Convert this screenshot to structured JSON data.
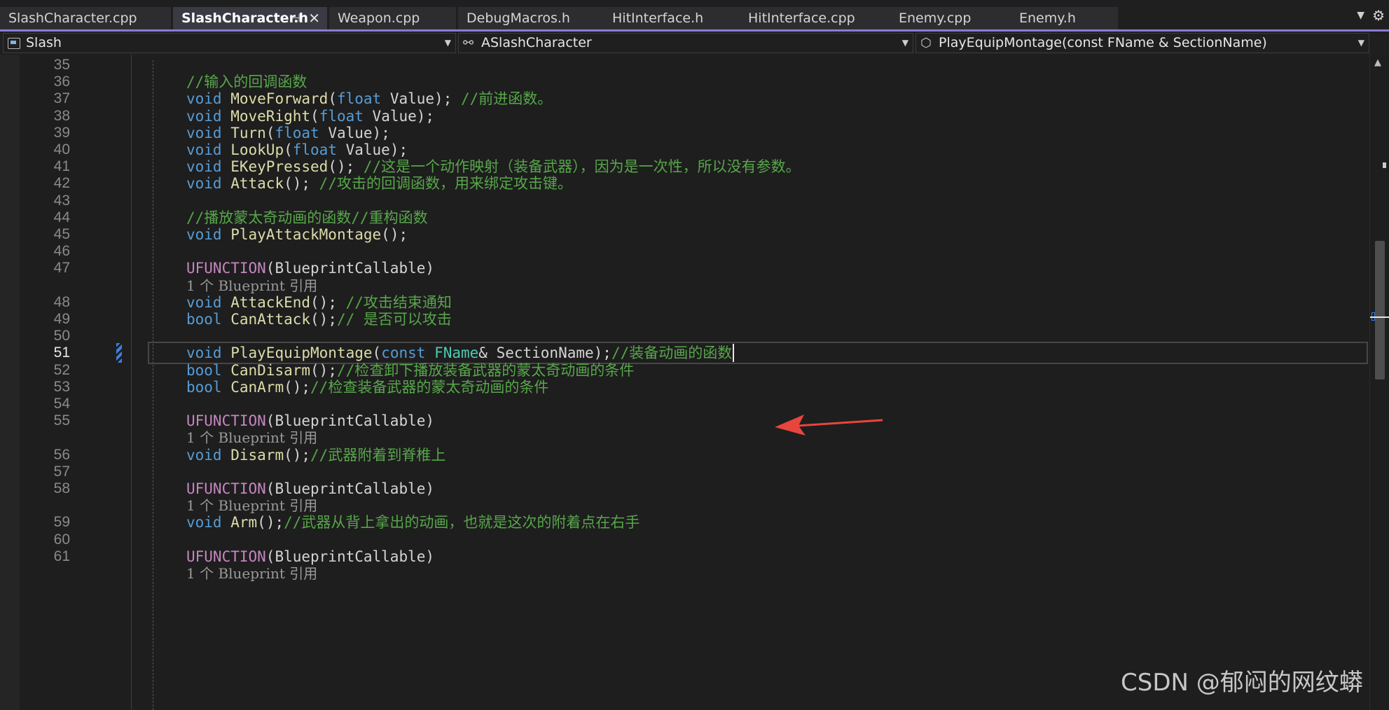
{
  "tabs": [
    {
      "label": "SlashCharacter.cpp",
      "active": false
    },
    {
      "label": "SlashCharacter.h",
      "active": true
    },
    {
      "label": "Weapon.cpp",
      "active": false
    },
    {
      "label": "DebugMacros.h",
      "active": false
    },
    {
      "label": "HitInterface.h",
      "active": false
    },
    {
      "label": "HitInterface.cpp",
      "active": false
    },
    {
      "label": "Enemy.cpp",
      "active": false
    },
    {
      "label": "Enemy.h",
      "active": false
    }
  ],
  "tab_active_pin_icon": "pin-icon",
  "tab_active_close": "✕",
  "navbar": {
    "project": "Slash",
    "scope": "ASlashCharacter",
    "member": "PlayEquipMontage(const FName & SectionName)"
  },
  "editor": {
    "current_line": 51,
    "lines": [
      {
        "n": "35",
        "tokens": []
      },
      {
        "n": "36",
        "tokens": [
          {
            "t": "//输入的回调函数",
            "c": "cm"
          }
        ]
      },
      {
        "n": "37",
        "tokens": [
          {
            "t": "void",
            "c": "kw"
          },
          {
            "t": " ",
            "c": "pl"
          },
          {
            "t": "MoveForward",
            "c": "fn"
          },
          {
            "t": "(",
            "c": "pl"
          },
          {
            "t": "float",
            "c": "kw"
          },
          {
            "t": " Value); ",
            "c": "pl"
          },
          {
            "t": "//前进函数。",
            "c": "cm"
          }
        ]
      },
      {
        "n": "38",
        "tokens": [
          {
            "t": "void",
            "c": "kw"
          },
          {
            "t": " ",
            "c": "pl"
          },
          {
            "t": "MoveRight",
            "c": "fn"
          },
          {
            "t": "(",
            "c": "pl"
          },
          {
            "t": "float",
            "c": "kw"
          },
          {
            "t": " Value);",
            "c": "pl"
          }
        ]
      },
      {
        "n": "39",
        "tokens": [
          {
            "t": "void",
            "c": "kw"
          },
          {
            "t": " ",
            "c": "pl"
          },
          {
            "t": "Turn",
            "c": "fn"
          },
          {
            "t": "(",
            "c": "pl"
          },
          {
            "t": "float",
            "c": "kw"
          },
          {
            "t": " Value);",
            "c": "pl"
          }
        ]
      },
      {
        "n": "40",
        "tokens": [
          {
            "t": "void",
            "c": "kw"
          },
          {
            "t": " ",
            "c": "pl"
          },
          {
            "t": "LookUp",
            "c": "fn"
          },
          {
            "t": "(",
            "c": "pl"
          },
          {
            "t": "float",
            "c": "kw"
          },
          {
            "t": " Value);",
            "c": "pl"
          }
        ]
      },
      {
        "n": "41",
        "tokens": [
          {
            "t": "void",
            "c": "kw"
          },
          {
            "t": " ",
            "c": "pl"
          },
          {
            "t": "EKeyPressed",
            "c": "fn"
          },
          {
            "t": "(); ",
            "c": "pl"
          },
          {
            "t": "//这是一个动作映射（装备武器），因为是一次性，所以没有参数。",
            "c": "cm"
          }
        ]
      },
      {
        "n": "42",
        "tokens": [
          {
            "t": "void",
            "c": "kw"
          },
          {
            "t": " ",
            "c": "pl"
          },
          {
            "t": "Attack",
            "c": "fn"
          },
          {
            "t": "(); ",
            "c": "pl"
          },
          {
            "t": "//攻击的回调函数，用来绑定攻击键。",
            "c": "cm"
          }
        ]
      },
      {
        "n": "43",
        "tokens": []
      },
      {
        "n": "44",
        "tokens": [
          {
            "t": "//播放蒙太奇动画的函数//重构函数",
            "c": "cm"
          }
        ]
      },
      {
        "n": "45",
        "tokens": [
          {
            "t": "void",
            "c": "kw"
          },
          {
            "t": " ",
            "c": "pl"
          },
          {
            "t": "PlayAttackMontage",
            "c": "fn"
          },
          {
            "t": "();",
            "c": "pl"
          }
        ]
      },
      {
        "n": "46",
        "tokens": []
      },
      {
        "n": "47",
        "tokens": [
          {
            "t": "UFUNCTION",
            "c": "mc"
          },
          {
            "t": "(BlueprintCallable)",
            "c": "pl"
          }
        ]
      },
      {
        "n": "",
        "hint": "1 个 Blueprint 引用"
      },
      {
        "n": "48",
        "tokens": [
          {
            "t": "void",
            "c": "kw"
          },
          {
            "t": " ",
            "c": "pl"
          },
          {
            "t": "AttackEnd",
            "c": "fn"
          },
          {
            "t": "(); ",
            "c": "pl"
          },
          {
            "t": "//攻击结束通知",
            "c": "cm"
          }
        ]
      },
      {
        "n": "49",
        "tokens": [
          {
            "t": "bool",
            "c": "kw"
          },
          {
            "t": " ",
            "c": "pl"
          },
          {
            "t": "CanAttack",
            "c": "fn"
          },
          {
            "t": "();",
            "c": "pl"
          },
          {
            "t": "// 是否可以攻击",
            "c": "cm"
          }
        ]
      },
      {
        "n": "50",
        "tokens": []
      },
      {
        "n": "51",
        "tokens": [
          {
            "t": "void",
            "c": "kw"
          },
          {
            "t": " ",
            "c": "pl"
          },
          {
            "t": "PlayEquipMontage",
            "c": "fn"
          },
          {
            "t": "(",
            "c": "pl"
          },
          {
            "t": "const",
            "c": "kw"
          },
          {
            "t": " ",
            "c": "pl"
          },
          {
            "t": "FName",
            "c": "ty"
          },
          {
            "t": "& ",
            "c": "pl"
          },
          {
            "t": "SectionName",
            "c": "pl"
          },
          {
            "t": ");",
            "c": "pl"
          },
          {
            "t": "//装备动画的函数",
            "c": "cm"
          }
        ]
      },
      {
        "n": "52",
        "tokens": [
          {
            "t": "bool",
            "c": "kw"
          },
          {
            "t": " ",
            "c": "pl"
          },
          {
            "t": "CanDisarm",
            "c": "fn"
          },
          {
            "t": "();",
            "c": "pl"
          },
          {
            "t": "//检查卸下播放装备武器的蒙太奇动画的条件",
            "c": "cm"
          }
        ]
      },
      {
        "n": "53",
        "tokens": [
          {
            "t": "bool",
            "c": "kw"
          },
          {
            "t": " ",
            "c": "pl"
          },
          {
            "t": "CanArm",
            "c": "fn"
          },
          {
            "t": "();",
            "c": "pl"
          },
          {
            "t": "//检查装备武器的蒙太奇动画的条件",
            "c": "cm"
          }
        ]
      },
      {
        "n": "54",
        "tokens": []
      },
      {
        "n": "55",
        "tokens": [
          {
            "t": "UFUNCTION",
            "c": "mc"
          },
          {
            "t": "(BlueprintCallable)",
            "c": "pl"
          }
        ]
      },
      {
        "n": "",
        "hint": "1 个 Blueprint 引用"
      },
      {
        "n": "56",
        "tokens": [
          {
            "t": "void",
            "c": "kw"
          },
          {
            "t": " ",
            "c": "pl"
          },
          {
            "t": "Disarm",
            "c": "fn"
          },
          {
            "t": "();",
            "c": "pl"
          },
          {
            "t": "//武器附着到脊椎上",
            "c": "cm"
          }
        ]
      },
      {
        "n": "57",
        "tokens": []
      },
      {
        "n": "58",
        "tokens": [
          {
            "t": "UFUNCTION",
            "c": "mc"
          },
          {
            "t": "(BlueprintCallable)",
            "c": "pl"
          }
        ]
      },
      {
        "n": "",
        "hint": "1 个 Blueprint 引用"
      },
      {
        "n": "59",
        "tokens": [
          {
            "t": "void",
            "c": "kw"
          },
          {
            "t": " ",
            "c": "pl"
          },
          {
            "t": "Arm",
            "c": "fn"
          },
          {
            "t": "();",
            "c": "pl"
          },
          {
            "t": "//武器从背上拿出的动画，也就是这次的附着点在右手",
            "c": "cm"
          }
        ]
      },
      {
        "n": "60",
        "tokens": []
      },
      {
        "n": "61",
        "tokens": [
          {
            "t": "UFUNCTION",
            "c": "mc"
          },
          {
            "t": "(BlueprintCallable)",
            "c": "pl"
          }
        ]
      },
      {
        "n": "",
        "hint": "1 个 Blueprint 引用"
      }
    ]
  },
  "colors": {
    "keyword": "#569cd6",
    "function": "#dcdcaa",
    "type": "#4ec9b0",
    "macro": "#c586c0",
    "comment": "#57a64a",
    "arrow": "#e8453c"
  },
  "watermark": "CSDN @郁闷的网纹蟒"
}
